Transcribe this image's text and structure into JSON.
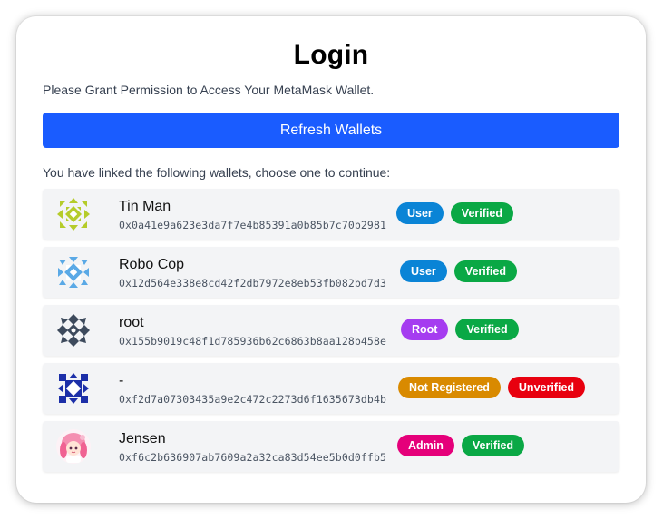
{
  "title": "Login",
  "subtitle": "Please Grant Permission to Access Your MetaMask Wallet.",
  "refresh_label": "Refresh Wallets",
  "linked_text": "You have linked the following wallets, choose one to continue:",
  "colors": {
    "primary": "#1a5cff",
    "user": "#0a84d6",
    "root": "#a53cf0",
    "admin": "#e5007a",
    "verified": "#0aa845",
    "not_registered": "#d98a00",
    "unverified": "#e8000f"
  },
  "wallets": [
    {
      "name": "Tin Man",
      "address": "0x0a41e9a623e3da7f7e4b85391a0b85b7c70b2981",
      "avatar": "identicon-icon",
      "role": {
        "label": "User",
        "color": "#0a84d6"
      },
      "status": {
        "label": "Verified",
        "color": "#0aa845"
      }
    },
    {
      "name": "Robo Cop",
      "address": "0x12d564e338e8cd42f2db7972e8eb53fb082bd7d3",
      "avatar": "identicon-icon",
      "role": {
        "label": "User",
        "color": "#0a84d6"
      },
      "status": {
        "label": "Verified",
        "color": "#0aa845"
      }
    },
    {
      "name": "root",
      "address": "0x155b9019c48f1d785936b62c6863b8aa128b458e",
      "avatar": "identicon-icon",
      "role": {
        "label": "Root",
        "color": "#a53cf0"
      },
      "status": {
        "label": "Verified",
        "color": "#0aa845"
      }
    },
    {
      "name": "-",
      "address": "0xf2d7a07303435a9e2c472c2273d6f1635673db4b",
      "avatar": "identicon-icon",
      "role": {
        "label": "Not Registered",
        "color": "#d98a00"
      },
      "status": {
        "label": "Unverified",
        "color": "#e8000f"
      }
    },
    {
      "name": "Jensen",
      "address": "0xf6c2b636907ab7609a2a32ca83d54ee5b0d0ffb5",
      "avatar": "anime-avatar-icon",
      "role": {
        "label": "Admin",
        "color": "#e5007a"
      },
      "status": {
        "label": "Verified",
        "color": "#0aa845"
      }
    }
  ]
}
